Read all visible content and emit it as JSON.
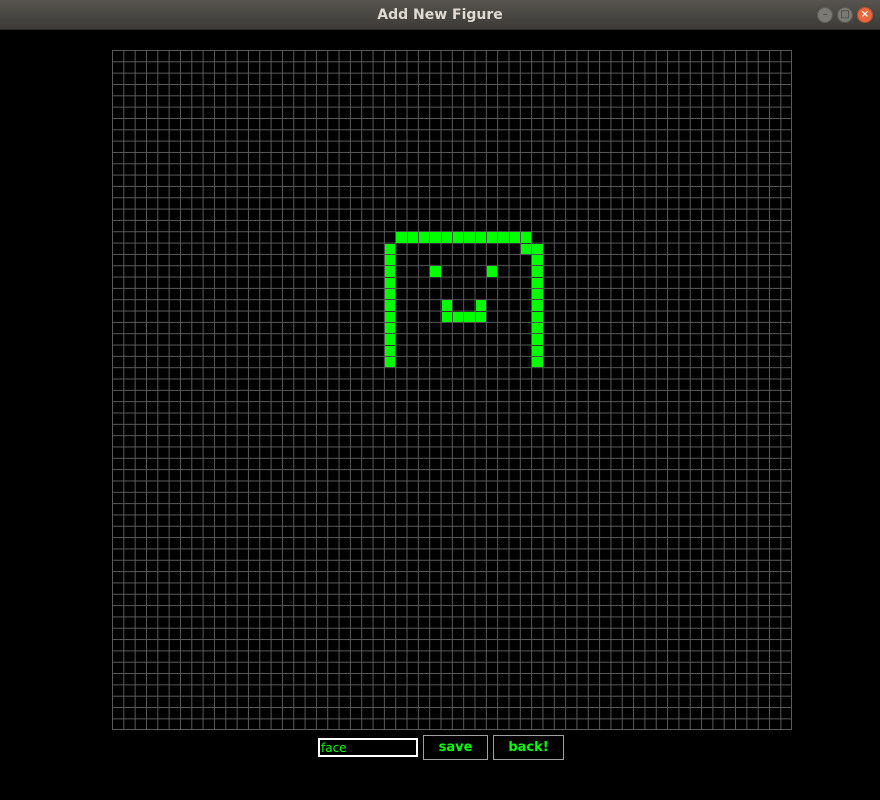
{
  "window": {
    "title": "Add New Figure",
    "controls": {
      "minimize_icon": "minimize-icon",
      "maximize_icon": "maximize-icon",
      "close_icon": "close-icon"
    }
  },
  "grid": {
    "columns": 60,
    "rows": 60,
    "cell_color": "#00ff00",
    "line_color": "#5a5a5a",
    "background": "#000000",
    "filled_cells": [
      [
        25,
        16
      ],
      [
        26,
        16
      ],
      [
        27,
        16
      ],
      [
        28,
        16
      ],
      [
        29,
        16
      ],
      [
        30,
        16
      ],
      [
        31,
        16
      ],
      [
        32,
        16
      ],
      [
        33,
        16
      ],
      [
        34,
        16
      ],
      [
        35,
        16
      ],
      [
        36,
        16
      ],
      [
        24,
        17
      ],
      [
        24,
        18
      ],
      [
        24,
        19
      ],
      [
        24,
        20
      ],
      [
        24,
        21
      ],
      [
        24,
        22
      ],
      [
        24,
        23
      ],
      [
        24,
        24
      ],
      [
        24,
        25
      ],
      [
        24,
        26
      ],
      [
        24,
        27
      ],
      [
        36,
        17
      ],
      [
        37,
        17
      ],
      [
        37,
        18
      ],
      [
        37,
        19
      ],
      [
        37,
        20
      ],
      [
        37,
        21
      ],
      [
        37,
        22
      ],
      [
        37,
        23
      ],
      [
        37,
        24
      ],
      [
        37,
        25
      ],
      [
        37,
        26
      ],
      [
        37,
        27
      ],
      [
        28,
        19
      ],
      [
        33,
        19
      ],
      [
        29,
        22
      ],
      [
        32,
        22
      ],
      [
        29,
        23
      ],
      [
        30,
        23
      ],
      [
        31,
        23
      ],
      [
        32,
        23
      ]
    ]
  },
  "form": {
    "name_value": "face",
    "save_label": "save",
    "back_label": "back!"
  }
}
